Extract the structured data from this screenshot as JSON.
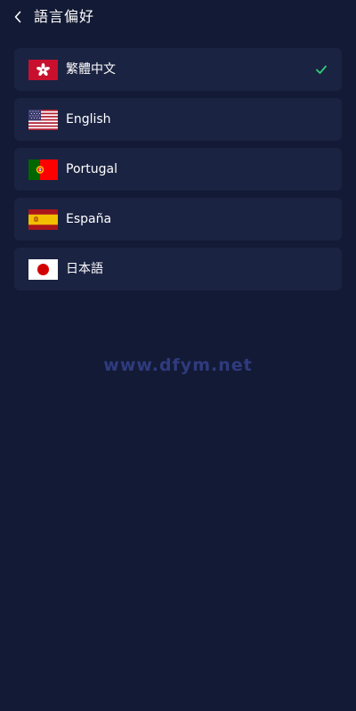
{
  "header": {
    "back_icon": "chevron-left-icon",
    "title": "語言偏好"
  },
  "languages": [
    {
      "label": "繁體中文",
      "flag_icon": "hong-kong-flag-icon",
      "selected": true
    },
    {
      "label": "English",
      "flag_icon": "us-flag-icon",
      "selected": false
    },
    {
      "label": "Portugal",
      "flag_icon": "portugal-flag-icon",
      "selected": false
    },
    {
      "label": "España",
      "flag_icon": "spain-flag-icon",
      "selected": false
    },
    {
      "label": "日本語",
      "flag_icon": "japan-flag-icon",
      "selected": false
    }
  ],
  "check_icon": "checkmark-icon",
  "watermark": "www.dfym.net",
  "colors": {
    "background": "#131a35",
    "card": "#1b2342",
    "check": "#2fcf77",
    "watermark": "#2f3b7e"
  }
}
